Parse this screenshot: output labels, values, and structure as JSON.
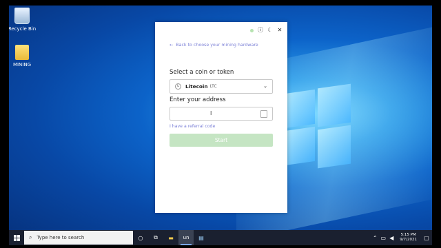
{
  "desktop": {
    "icons": [
      {
        "label": "Recycle Bin"
      },
      {
        "label": "MINING"
      }
    ]
  },
  "popup": {
    "back_link": "Back to choose your mining hardware",
    "coin_heading": "Select a coin or token",
    "coin": {
      "name": "Litecoin",
      "ticker": "LTC"
    },
    "address_heading": "Enter your address",
    "address_value": "",
    "referral_link": "I have a referral code",
    "start_button": "Start"
  },
  "taskbar": {
    "search_placeholder": "Type here to search",
    "apps": [
      "un"
    ],
    "clock": {
      "time": "5:15 PM",
      "date": "9/7/2021"
    }
  },
  "colors": {
    "accent_link": "#7a7fd6",
    "start_disabled": "#c5e5c3",
    "taskbar": "#1a2030"
  }
}
